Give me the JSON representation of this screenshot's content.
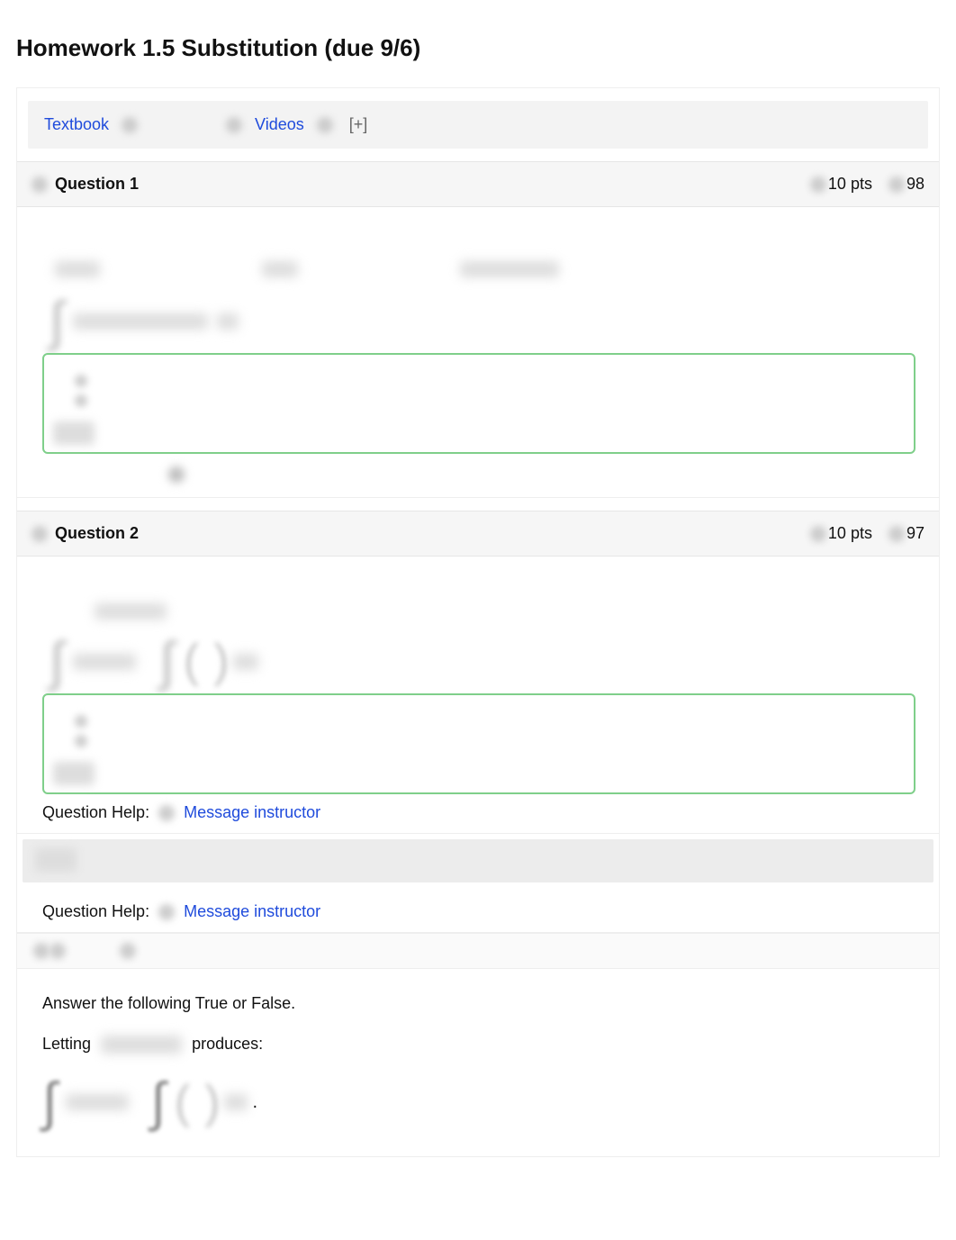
{
  "title": "Homework 1.5 Substitution (due 9/6)",
  "resources": {
    "textbook": "Textbook",
    "videos": "Videos",
    "expand": "[+]"
  },
  "q1": {
    "label": "Question 1",
    "pts": "10 pts",
    "attempts": "98"
  },
  "q2": {
    "label": "Question 2",
    "pts": "10 pts",
    "attempts": "97",
    "help_label": "Question Help:",
    "help_link": "Message instructor"
  },
  "q2b": {
    "help_label": "Question Help:",
    "help_link": "Message instructor"
  },
  "q3": {
    "intro": "Answer the following True or False.",
    "letting": "Letting",
    "produces": "produces:"
  }
}
